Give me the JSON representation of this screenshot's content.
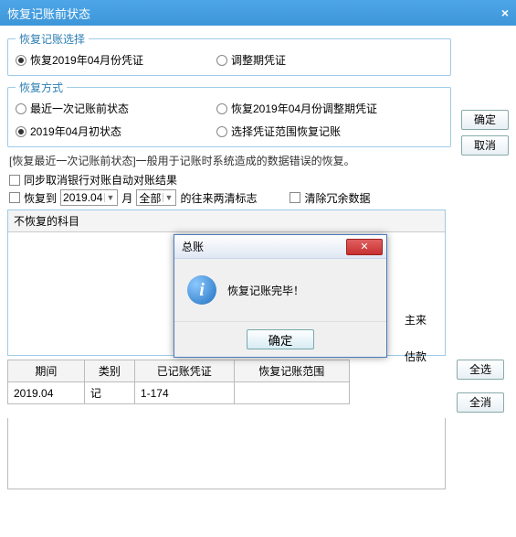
{
  "titlebar": {
    "title": "恢复记账前状态",
    "close": "×"
  },
  "group1": {
    "legend": "恢复记账选择",
    "opt1": "恢复2019年04月份凭证",
    "opt2": "调整期凭证"
  },
  "group2": {
    "legend": "恢复方式",
    "opt1": "最近一次记账前状态",
    "opt2": "恢复2019年04月份调整期凭证",
    "opt3": "2019年04月初状态",
    "opt4": "选择凭证范围恢复记账"
  },
  "side": {
    "ok": "确定",
    "cancel": "取消"
  },
  "help": "[恢复最近一次记账前状态]一般用于记账时系统造成的数据错误的恢复。",
  "check1": "同步取消银行对账自动对账结果",
  "row2": {
    "label1": "恢复到",
    "period": "2019.04",
    "label2": "月",
    "all": "全部",
    "label3": "的往来两清标志",
    "check2": "清除冗余数据"
  },
  "listbox": {
    "header": "不恢复的科目",
    "item1": "主来",
    "item2": "",
    "item3": "估款"
  },
  "table": {
    "h1": "期间",
    "h2": "类别",
    "h3": "已记账凭证",
    "h4": "恢复记账范围",
    "r1c1": "2019.04",
    "r1c2": "记",
    "r1c3": "1-174",
    "r1c4": ""
  },
  "tblside": {
    "all": "全选",
    "none": "全消"
  },
  "modal": {
    "title": "总账",
    "message": "恢复记账完毕！",
    "ok": "确定"
  }
}
